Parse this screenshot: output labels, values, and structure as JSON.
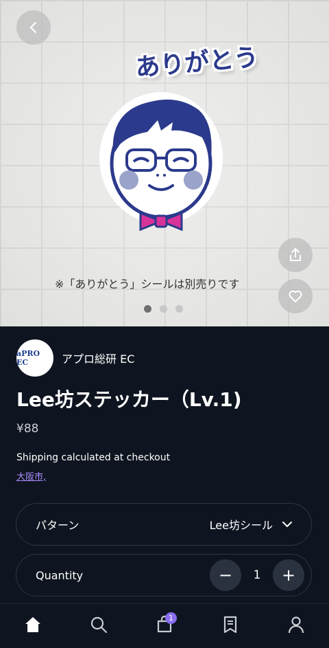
{
  "hero": {
    "sticker_text": "ありがとう",
    "caption": "※「ありがとう」シールは別売りです",
    "dots": [
      true,
      false,
      false
    ]
  },
  "vendor": {
    "logo_text": "aPRO EC",
    "name": "アプロ総研 EC"
  },
  "product": {
    "title": "Lee坊ステッカー（Lv.1)",
    "price": "¥88",
    "shipping": "Shipping calculated at checkout",
    "location": "大阪市,"
  },
  "pattern": {
    "label": "パターン",
    "selected": "Lee坊シール"
  },
  "quantity": {
    "label": "Quantity",
    "value": "1",
    "minus": "−",
    "plus": "+"
  },
  "nav": {
    "cart_badge": "1",
    "items": [
      "home-icon",
      "search-icon",
      "cart-icon",
      "catalog-icon",
      "account-icon"
    ]
  },
  "colors": {
    "accent": "#8a6df0",
    "background": "#0f1520"
  }
}
